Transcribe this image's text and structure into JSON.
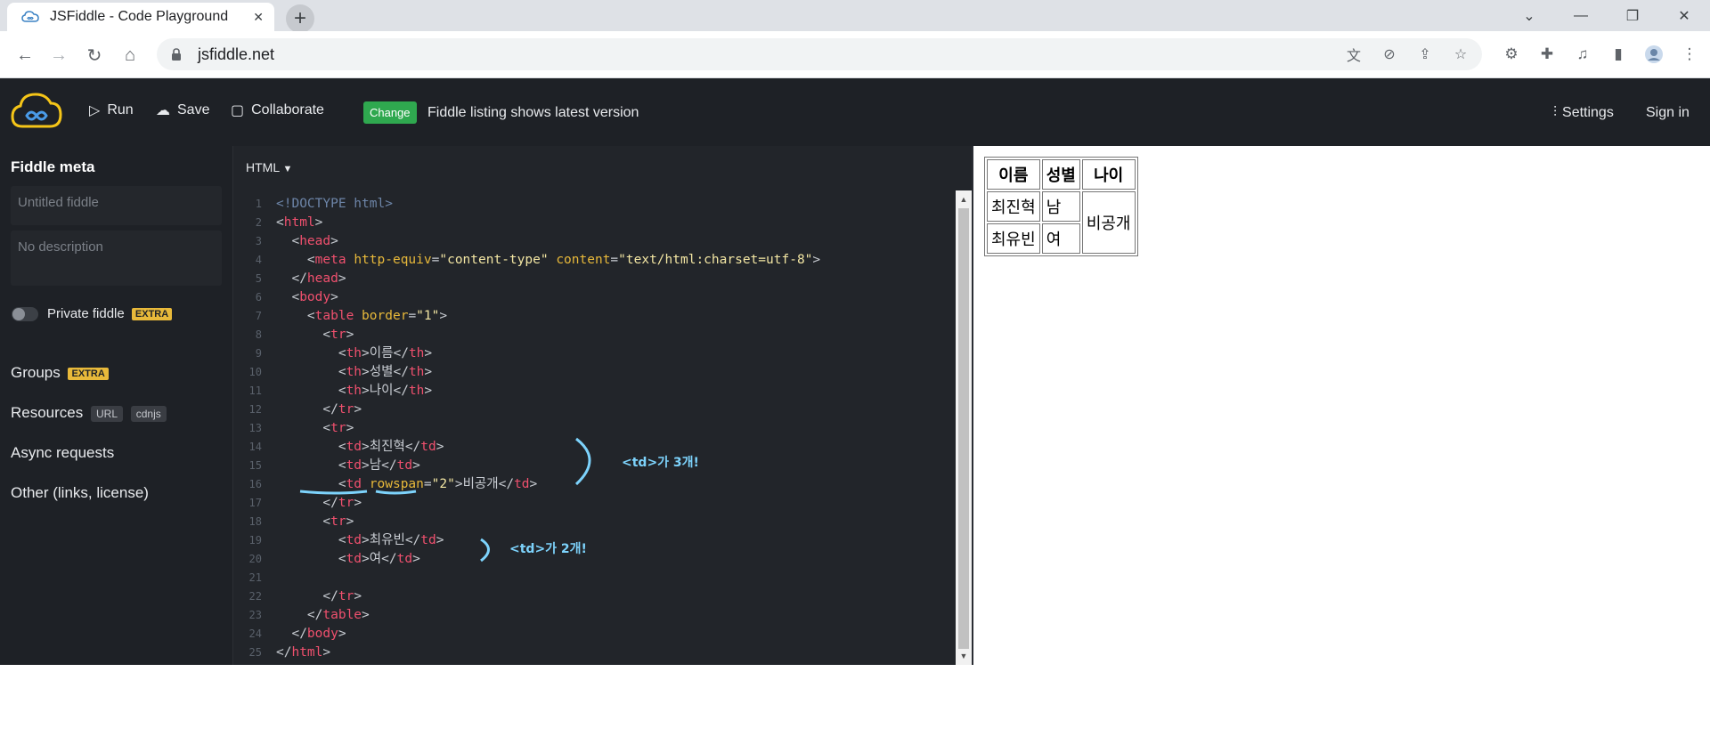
{
  "browser": {
    "tab_title": "JSFiddle - Code Playground",
    "url": "jsfiddle.net"
  },
  "header": {
    "run": "Run",
    "save": "Save",
    "collaborate": "Collaborate",
    "change_badge": "Change",
    "listing_text": "Fiddle listing shows latest version",
    "settings": "Settings",
    "sign_in": "Sign in"
  },
  "sidebar": {
    "title": "Fiddle meta",
    "title_placeholder": "Untitled fiddle",
    "description_placeholder": "No description",
    "private_label": "Private fiddle",
    "extra": "EXTRA",
    "groups": "Groups",
    "resources": "Resources",
    "resources_chips": [
      "URL",
      "cdnjs"
    ],
    "async": "Async requests",
    "other": "Other (links, license)"
  },
  "editor": {
    "language": "HTML",
    "annotation_1": "<td>가 3개!",
    "annotation_2": "<td>가 2개!",
    "lines": [
      [
        [
          "t-doc",
          "<!DOCTYPE html>"
        ]
      ],
      [
        [
          "t-pun",
          "<"
        ],
        [
          "t-tag",
          "html"
        ],
        [
          "t-pun",
          ">"
        ]
      ],
      [
        [
          "t-pun",
          "  <"
        ],
        [
          "t-tag",
          "head"
        ],
        [
          "t-pun",
          ">"
        ]
      ],
      [
        [
          "t-pun",
          "    <"
        ],
        [
          "t-tag",
          "meta"
        ],
        [
          "t-pun",
          " "
        ],
        [
          "t-attr",
          "http-equiv"
        ],
        [
          "t-pun",
          "="
        ],
        [
          "t-str",
          "\"content-type\""
        ],
        [
          "t-pun",
          " "
        ],
        [
          "t-attr",
          "content"
        ],
        [
          "t-pun",
          "="
        ],
        [
          "t-str",
          "\"text/html:charset=utf-8\""
        ],
        [
          "t-pun",
          ">"
        ]
      ],
      [
        [
          "t-pun",
          "  </"
        ],
        [
          "t-tag",
          "head"
        ],
        [
          "t-pun",
          ">"
        ]
      ],
      [
        [
          "t-pun",
          "  <"
        ],
        [
          "t-tag",
          "body"
        ],
        [
          "t-pun",
          ">"
        ]
      ],
      [
        [
          "t-pun",
          "    <"
        ],
        [
          "t-tag",
          "table"
        ],
        [
          "t-pun",
          " "
        ],
        [
          "t-attr",
          "border"
        ],
        [
          "t-pun",
          "="
        ],
        [
          "t-str",
          "\"1\""
        ],
        [
          "t-pun",
          ">"
        ]
      ],
      [
        [
          "t-pun",
          "      <"
        ],
        [
          "t-tag",
          "tr"
        ],
        [
          "t-pun",
          ">"
        ]
      ],
      [
        [
          "t-pun",
          "        <"
        ],
        [
          "t-tag",
          "th"
        ],
        [
          "t-pun",
          ">"
        ],
        [
          "t-txt",
          "이름"
        ],
        [
          "t-pun",
          "</"
        ],
        [
          "t-tag",
          "th"
        ],
        [
          "t-pun",
          ">"
        ]
      ],
      [
        [
          "t-pun",
          "        <"
        ],
        [
          "t-tag",
          "th"
        ],
        [
          "t-pun",
          ">"
        ],
        [
          "t-txt",
          "성별"
        ],
        [
          "t-pun",
          "</"
        ],
        [
          "t-tag",
          "th"
        ],
        [
          "t-pun",
          ">"
        ]
      ],
      [
        [
          "t-pun",
          "        <"
        ],
        [
          "t-tag",
          "th"
        ],
        [
          "t-pun",
          ">"
        ],
        [
          "t-txt",
          "나이"
        ],
        [
          "t-pun",
          "</"
        ],
        [
          "t-tag",
          "th"
        ],
        [
          "t-pun",
          ">"
        ]
      ],
      [
        [
          "t-pun",
          "      </"
        ],
        [
          "t-tag",
          "tr"
        ],
        [
          "t-pun",
          ">"
        ]
      ],
      [
        [
          "t-pun",
          "      <"
        ],
        [
          "t-tag",
          "tr"
        ],
        [
          "t-pun",
          ">"
        ]
      ],
      [
        [
          "t-pun",
          "        <"
        ],
        [
          "t-tag",
          "td"
        ],
        [
          "t-pun",
          ">"
        ],
        [
          "t-txt",
          "최진혁"
        ],
        [
          "t-pun",
          "</"
        ],
        [
          "t-tag",
          "td"
        ],
        [
          "t-pun",
          ">"
        ]
      ],
      [
        [
          "t-pun",
          "        <"
        ],
        [
          "t-tag",
          "td"
        ],
        [
          "t-pun",
          ">"
        ],
        [
          "t-txt",
          "남"
        ],
        [
          "t-pun",
          "</"
        ],
        [
          "t-tag",
          "td"
        ],
        [
          "t-pun",
          ">"
        ]
      ],
      [
        [
          "t-pun",
          "        <"
        ],
        [
          "t-tag",
          "td"
        ],
        [
          "t-pun",
          " "
        ],
        [
          "t-attr",
          "rowspan"
        ],
        [
          "t-pun",
          "="
        ],
        [
          "t-str",
          "\"2\""
        ],
        [
          "t-pun",
          ">"
        ],
        [
          "t-txt",
          "비공개"
        ],
        [
          "t-pun",
          "</"
        ],
        [
          "t-tag",
          "td"
        ],
        [
          "t-pun",
          ">"
        ]
      ],
      [
        [
          "t-pun",
          "      </"
        ],
        [
          "t-tag",
          "tr"
        ],
        [
          "t-pun",
          ">"
        ]
      ],
      [
        [
          "t-pun",
          "      <"
        ],
        [
          "t-tag",
          "tr"
        ],
        [
          "t-pun",
          ">"
        ]
      ],
      [
        [
          "t-pun",
          "        <"
        ],
        [
          "t-tag",
          "td"
        ],
        [
          "t-pun",
          ">"
        ],
        [
          "t-txt",
          "최유빈"
        ],
        [
          "t-pun",
          "</"
        ],
        [
          "t-tag",
          "td"
        ],
        [
          "t-pun",
          ">"
        ]
      ],
      [
        [
          "t-pun",
          "        <"
        ],
        [
          "t-tag",
          "td"
        ],
        [
          "t-pun",
          ">"
        ],
        [
          "t-txt",
          "여"
        ],
        [
          "t-pun",
          "</"
        ],
        [
          "t-tag",
          "td"
        ],
        [
          "t-pun",
          ">"
        ]
      ],
      [],
      [
        [
          "t-pun",
          "      </"
        ],
        [
          "t-tag",
          "tr"
        ],
        [
          "t-pun",
          ">"
        ]
      ],
      [
        [
          "t-pun",
          "    </"
        ],
        [
          "t-tag",
          "table"
        ],
        [
          "t-pun",
          ">"
        ]
      ],
      [
        [
          "t-pun",
          "  </"
        ],
        [
          "t-tag",
          "body"
        ],
        [
          "t-pun",
          ">"
        ]
      ],
      [
        [
          "t-pun",
          "</"
        ],
        [
          "t-tag",
          "html"
        ],
        [
          "t-pun",
          ">"
        ]
      ]
    ]
  },
  "result": {
    "headers": [
      "이름",
      "성별",
      "나이"
    ],
    "row1": [
      "최진혁",
      "남",
      "비공개"
    ],
    "row2": [
      "최유빈",
      "여"
    ]
  },
  "colors": {
    "jsfiddle_bg": "#1e2126",
    "editor_bg": "#22252a",
    "change_green": "#2fa84f",
    "extra_yellow": "#e8b93a",
    "annotation_blue": "#7dd3fc"
  }
}
